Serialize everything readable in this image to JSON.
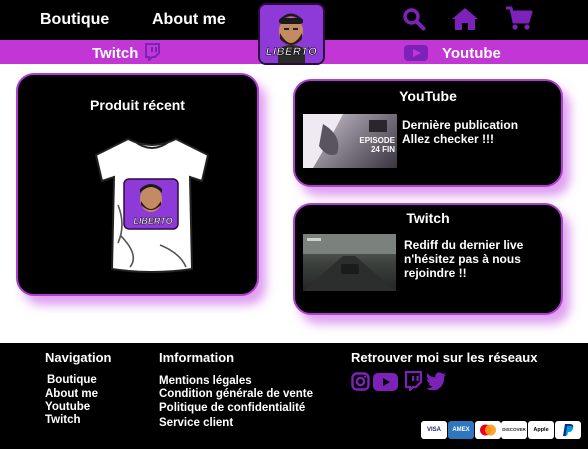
{
  "header": {
    "nav": [
      "Boutique",
      "About me"
    ],
    "logo_text": "LIBERTO",
    "icons": [
      "search-icon",
      "home-icon",
      "cart-icon"
    ],
    "accent": "#7d22b8"
  },
  "subbar": {
    "twitch_label": "Twitch",
    "youtube_label": "Youtube",
    "bg": "#c236d6"
  },
  "recent_product": {
    "title": "Produit récent",
    "logo_text": "LIBERTO"
  },
  "youtube_card": {
    "title": "YouTube",
    "text_line1": "Dernière publication",
    "text_line2": "Allez checker !!!",
    "thumb_text": "EPISODE 24 FIN"
  },
  "twitch_card": {
    "title": "Twitch",
    "text_line1": "Rediff du dernier live",
    "text_line2": "n'hésitez pas à nous",
    "text_line3": "rejoindre !!"
  },
  "footer": {
    "nav_title": "Navigation",
    "nav_links": [
      "Boutique",
      "About me",
      "Youtube",
      "Twitch"
    ],
    "info_title": "Imformation",
    "info_links": [
      "Mentions légales",
      "Condition générale de vente",
      "Politique de confidentialité",
      "Service client"
    ],
    "social_title": "Retrouver moi sur les réseaux",
    "payments": [
      "VISA",
      "AMEX",
      "Mastercard",
      "DISCOVER",
      "Apple Pay",
      "PayPal"
    ]
  }
}
